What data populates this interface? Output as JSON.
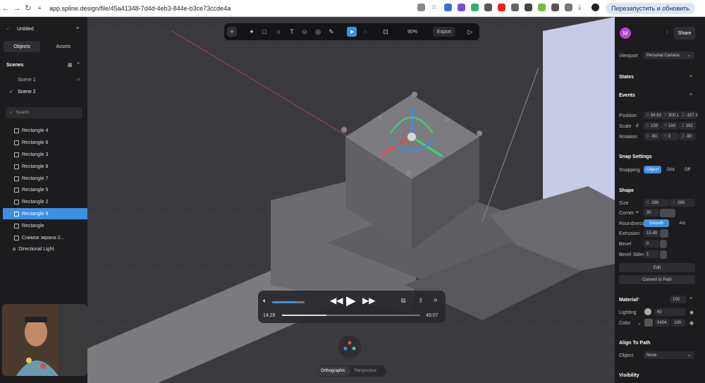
{
  "browser": {
    "url": "app.spline.design/file/45a41348-7d4d-4eb3-844e-b3ce73ccde4a",
    "restart_label": "Перезапустить и обновить"
  },
  "left_panel": {
    "title": "Untitled",
    "tabs": [
      "Objects",
      "Assets"
    ],
    "scenes_label": "Scenes",
    "scenes": [
      "Scene 1",
      "Scene 2"
    ],
    "search_placeholder": "Search",
    "objects": [
      "Rectangle 4",
      "Rectangle 6",
      "Rectangle 3",
      "Rectangle 8",
      "Rectangle 7",
      "Rectangle 5",
      "Rectangle 2",
      "Rectangle 9",
      "Rectangle",
      "Снимок экрана 2...",
      "Directional Light"
    ],
    "selected_object": "Rectangle 9"
  },
  "toolbar": {
    "zoom": "90%",
    "export_label": "Export"
  },
  "player": {
    "current_time": "14:28",
    "total_time": "45:07",
    "volume": 0.75,
    "progress": 0.32
  },
  "view_toggle": [
    "Orthographic",
    "Perspective"
  ],
  "right_panel": {
    "avatar_letter": "M",
    "share_label": "Share",
    "viewport_label": "Viewport",
    "viewport_value": "Personal Camera",
    "states_label": "States",
    "events_label": "Events",
    "position_label": "Position",
    "position": [
      "X",
      "84.63",
      "Y",
      "300.1",
      "Z",
      "-157.3"
    ],
    "scale_label": "Scale",
    "scale": [
      "X",
      "100",
      "Y",
      "100",
      "Z",
      "192"
    ],
    "rotation_label": "Rotation",
    "rotation": [
      "X",
      "-90",
      "Y",
      "0",
      "Z",
      "-90"
    ],
    "snap_label": "Snap Settings",
    "snapping_label": "Snapping",
    "snapping_options": [
      "Object",
      "Grid",
      "Off"
    ],
    "shape_label": "Shape",
    "size_label": "Size",
    "size": [
      "X",
      "290",
      "Y",
      "290"
    ],
    "corner_label": "Corner",
    "corner_value": "30",
    "roundness_label": "Roundness",
    "roundness_options": [
      "Smooth",
      "Arc"
    ],
    "extrusion_label": "Extrusion",
    "extrusion_value": "15.49",
    "bevel_label": "Bevel",
    "bevel_value": "0",
    "bevel_sides_label": "Bevel Sides",
    "bevel_sides_value": "1",
    "edit_label": "Edit",
    "convert_label": "Convert to Path",
    "material_label": "Material",
    "material_value": "100",
    "lighting_label": "Lighting",
    "lighting_value": "60",
    "color_label": "Color",
    "color_hex": "5454",
    "color_opacity": "100",
    "align_label": "Align To Path",
    "align_object_label": "Object",
    "align_object_value": "None",
    "visibility_label": "Visibility"
  },
  "colors": {
    "accent": "#3d8fe0",
    "panel": "#1c1c1f",
    "viewport": "#3a3a3e"
  }
}
